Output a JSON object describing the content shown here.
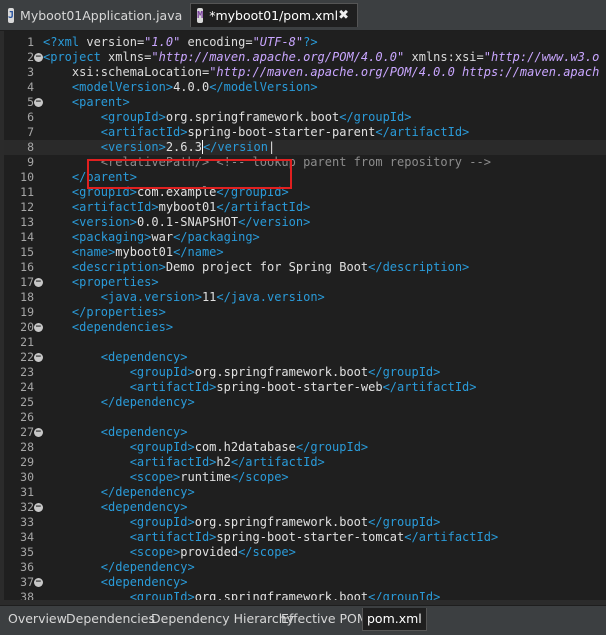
{
  "tabs": [
    {
      "label": "Myboot01Application.java",
      "icon": "java-file-icon"
    },
    {
      "label": "*myboot01/pom.xml",
      "icon": "xml-file-icon",
      "close": "✖"
    }
  ],
  "bottom_tabs": [
    "Overview",
    "Dependencies",
    "Dependency Hierarchy",
    "Effective POM",
    "pom.xml"
  ],
  "active_bottom_tab": "pom.xml",
  "colors": {
    "highlight_box": "#e02020",
    "tag": "#2a9bd9",
    "value": "#c9a6ff"
  },
  "lines": [
    {
      "n": "1",
      "fold": "",
      "tokens": [
        [
          "b",
          "<?"
        ],
        [
          "b",
          "xml "
        ],
        [
          "a",
          "version"
        ],
        [
          "t",
          "="
        ],
        [
          "v",
          "\"1.0\""
        ],
        [
          "t",
          " "
        ],
        [
          "a",
          "encoding"
        ],
        [
          "t",
          "="
        ],
        [
          "v",
          "\"UTF-8\""
        ],
        [
          "b",
          "?>"
        ]
      ]
    },
    {
      "n": "2",
      "fold": "−",
      "tokens": [
        [
          "b",
          "<project "
        ],
        [
          "a",
          "xmlns"
        ],
        [
          "t",
          "="
        ],
        [
          "v",
          "\"http://maven.apache.org/POM/4.0.0\""
        ],
        [
          "t",
          " "
        ],
        [
          "a",
          "xmlns:xsi"
        ],
        [
          "t",
          "="
        ],
        [
          "v",
          "\"http://www.w3.o"
        ]
      ]
    },
    {
      "n": "3",
      "fold": "",
      "tokens": [
        [
          "t",
          "    "
        ],
        [
          "a",
          "xsi:schemaLocation"
        ],
        [
          "t",
          "="
        ],
        [
          "v",
          "\"http://maven.apache.org/POM/4.0.0 https://maven.apach"
        ]
      ]
    },
    {
      "n": "4",
      "fold": "",
      "tokens": [
        [
          "t",
          "    "
        ],
        [
          "b",
          "<modelVersion>"
        ],
        [
          "t",
          "4.0.0"
        ],
        [
          "b",
          "</modelVersion>"
        ]
      ]
    },
    {
      "n": "5",
      "fold": "−",
      "tokens": [
        [
          "t",
          "    "
        ],
        [
          "b",
          "<parent>"
        ]
      ]
    },
    {
      "n": "6",
      "fold": "",
      "tokens": [
        [
          "t",
          "        "
        ],
        [
          "b",
          "<groupId>"
        ],
        [
          "t",
          "org.springframework.boot"
        ],
        [
          "b",
          "</groupId>"
        ]
      ]
    },
    {
      "n": "7",
      "fold": "",
      "tokens": [
        [
          "t",
          "        "
        ],
        [
          "b",
          "<artifactId>"
        ],
        [
          "t",
          "spring-boot-starter-parent"
        ],
        [
          "b",
          "</artifactId>"
        ]
      ]
    },
    {
      "n": "8",
      "fold": "",
      "hl": true,
      "tokens": [
        [
          "t",
          "        "
        ],
        [
          "b",
          "<version>"
        ],
        [
          "t",
          "2.6.3"
        ],
        [
          "caret",
          ""
        ],
        [
          "b",
          "</version"
        ],
        [
          "t",
          "|"
        ]
      ]
    },
    {
      "n": "9",
      "fold": "",
      "tokens": [
        [
          "t",
          "        "
        ],
        [
          "c",
          "<relativePath/> <!-- lookup parent from repository -->"
        ]
      ]
    },
    {
      "n": "10",
      "fold": "",
      "tokens": [
        [
          "t",
          "    "
        ],
        [
          "b",
          "</parent>"
        ]
      ]
    },
    {
      "n": "11",
      "fold": "",
      "tokens": [
        [
          "t",
          "    "
        ],
        [
          "b",
          "<groupId>"
        ],
        [
          "t",
          "com.example"
        ],
        [
          "b",
          "</groupId>"
        ]
      ]
    },
    {
      "n": "12",
      "fold": "",
      "tokens": [
        [
          "t",
          "    "
        ],
        [
          "b",
          "<artifactId>"
        ],
        [
          "t",
          "myboot01"
        ],
        [
          "b",
          "</artifactId>"
        ]
      ]
    },
    {
      "n": "13",
      "fold": "",
      "tokens": [
        [
          "t",
          "    "
        ],
        [
          "b",
          "<version>"
        ],
        [
          "t",
          "0.0.1-SNAPSHOT"
        ],
        [
          "b",
          "</version>"
        ]
      ]
    },
    {
      "n": "14",
      "fold": "",
      "tokens": [
        [
          "t",
          "    "
        ],
        [
          "b",
          "<packaging>"
        ],
        [
          "t",
          "war"
        ],
        [
          "b",
          "</packaging>"
        ]
      ]
    },
    {
      "n": "15",
      "fold": "",
      "tokens": [
        [
          "t",
          "    "
        ],
        [
          "b",
          "<name>"
        ],
        [
          "t",
          "myboot01"
        ],
        [
          "b",
          "</name>"
        ]
      ]
    },
    {
      "n": "16",
      "fold": "",
      "tokens": [
        [
          "t",
          "    "
        ],
        [
          "b",
          "<description>"
        ],
        [
          "t",
          "Demo project for Spring Boot"
        ],
        [
          "b",
          "</description>"
        ]
      ]
    },
    {
      "n": "17",
      "fold": "−",
      "tokens": [
        [
          "t",
          "    "
        ],
        [
          "b",
          "<properties>"
        ]
      ]
    },
    {
      "n": "18",
      "fold": "",
      "tokens": [
        [
          "t",
          "        "
        ],
        [
          "b",
          "<java.version>"
        ],
        [
          "t",
          "11"
        ],
        [
          "b",
          "</java.version>"
        ]
      ]
    },
    {
      "n": "19",
      "fold": "",
      "tokens": [
        [
          "t",
          "    "
        ],
        [
          "b",
          "</properties>"
        ]
      ]
    },
    {
      "n": "20",
      "fold": "−",
      "tokens": [
        [
          "t",
          "    "
        ],
        [
          "b",
          "<dependencies>"
        ]
      ]
    },
    {
      "n": "21",
      "fold": "",
      "tokens": []
    },
    {
      "n": "22",
      "fold": "−",
      "tokens": [
        [
          "t",
          "        "
        ],
        [
          "b",
          "<dependency>"
        ]
      ]
    },
    {
      "n": "23",
      "fold": "",
      "tokens": [
        [
          "t",
          "            "
        ],
        [
          "b",
          "<groupId>"
        ],
        [
          "t",
          "org.springframework.boot"
        ],
        [
          "b",
          "</groupId>"
        ]
      ]
    },
    {
      "n": "24",
      "fold": "",
      "tokens": [
        [
          "t",
          "            "
        ],
        [
          "b",
          "<artifactId>"
        ],
        [
          "t",
          "spring-boot-starter-web"
        ],
        [
          "b",
          "</artifactId>"
        ]
      ]
    },
    {
      "n": "25",
      "fold": "",
      "tokens": [
        [
          "t",
          "        "
        ],
        [
          "b",
          "</dependency>"
        ]
      ]
    },
    {
      "n": "26",
      "fold": "",
      "tokens": []
    },
    {
      "n": "27",
      "fold": "−",
      "tokens": [
        [
          "t",
          "        "
        ],
        [
          "b",
          "<dependency>"
        ]
      ]
    },
    {
      "n": "28",
      "fold": "",
      "tokens": [
        [
          "t",
          "            "
        ],
        [
          "b",
          "<groupId>"
        ],
        [
          "t",
          "com.h2database"
        ],
        [
          "b",
          "</groupId>"
        ]
      ]
    },
    {
      "n": "29",
      "fold": "",
      "tokens": [
        [
          "t",
          "            "
        ],
        [
          "b",
          "<artifactId>"
        ],
        [
          "t",
          "h2"
        ],
        [
          "b",
          "</artifactId>"
        ]
      ]
    },
    {
      "n": "30",
      "fold": "",
      "tokens": [
        [
          "t",
          "            "
        ],
        [
          "b",
          "<scope>"
        ],
        [
          "t",
          "runtime"
        ],
        [
          "b",
          "</scope>"
        ]
      ]
    },
    {
      "n": "31",
      "fold": "",
      "tokens": [
        [
          "t",
          "        "
        ],
        [
          "b",
          "</dependency>"
        ]
      ]
    },
    {
      "n": "32",
      "fold": "−",
      "tokens": [
        [
          "t",
          "        "
        ],
        [
          "b",
          "<dependency>"
        ]
      ]
    },
    {
      "n": "33",
      "fold": "",
      "tokens": [
        [
          "t",
          "            "
        ],
        [
          "b",
          "<groupId>"
        ],
        [
          "t",
          "org.springframework.boot"
        ],
        [
          "b",
          "</groupId>"
        ]
      ]
    },
    {
      "n": "34",
      "fold": "",
      "tokens": [
        [
          "t",
          "            "
        ],
        [
          "b",
          "<artifactId>"
        ],
        [
          "t",
          "spring-boot-starter-tomcat"
        ],
        [
          "b",
          "</artifactId>"
        ]
      ]
    },
    {
      "n": "35",
      "fold": "",
      "tokens": [
        [
          "t",
          "            "
        ],
        [
          "b",
          "<scope>"
        ],
        [
          "t",
          "provided"
        ],
        [
          "b",
          "</scope>"
        ]
      ]
    },
    {
      "n": "36",
      "fold": "",
      "tokens": [
        [
          "t",
          "        "
        ],
        [
          "b",
          "</dependency>"
        ]
      ]
    },
    {
      "n": "37",
      "fold": "−",
      "tokens": [
        [
          "t",
          "        "
        ],
        [
          "b",
          "<dependency>"
        ]
      ]
    },
    {
      "n": "38",
      "fold": "",
      "tokens": [
        [
          "t",
          "            "
        ],
        [
          "b",
          "<groupId>"
        ],
        [
          "t",
          "org.springframework.boot"
        ],
        [
          "b",
          "</groupId>"
        ]
      ]
    }
  ]
}
